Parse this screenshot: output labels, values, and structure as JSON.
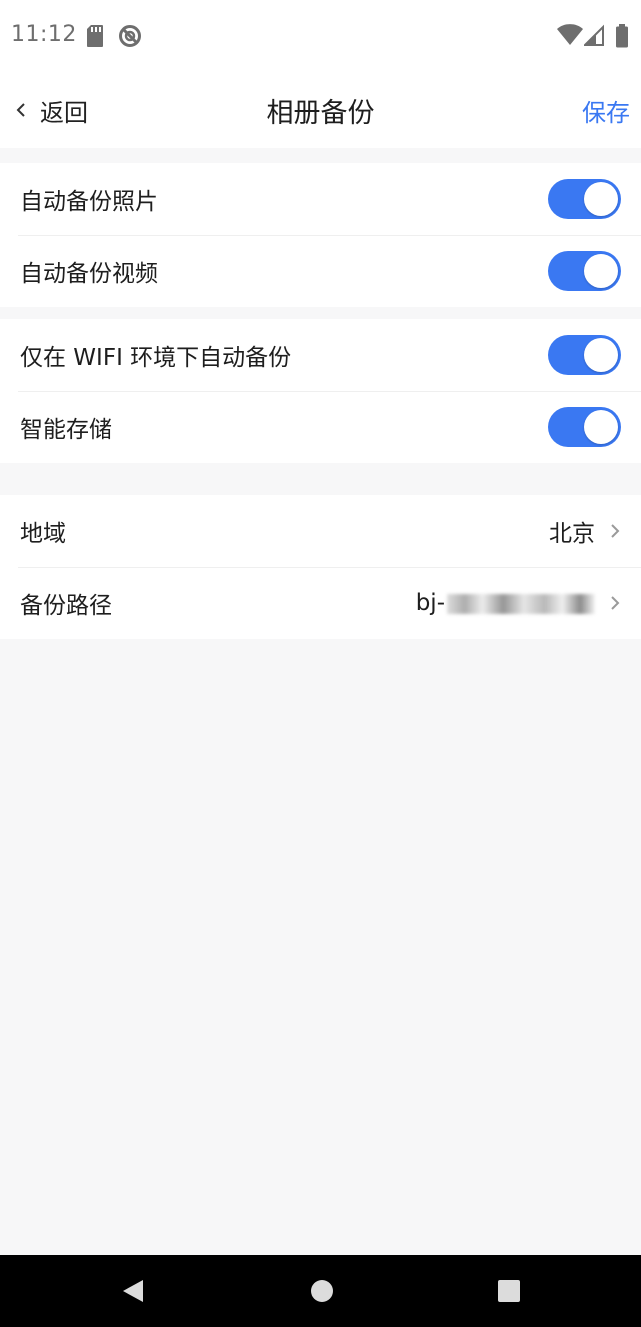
{
  "status_bar": {
    "time": "11:12",
    "left_icons": [
      "sd-card-icon",
      "no-disturb-icon"
    ],
    "right_icons": [
      "wifi-icon",
      "cell-signal-icon",
      "battery-icon"
    ]
  },
  "nav": {
    "back_label": "返回",
    "title": "相册备份",
    "save_label": "保存"
  },
  "groups": [
    {
      "rows": [
        {
          "label": "自动备份照片",
          "toggle_on": true
        },
        {
          "label": "自动备份视频",
          "toggle_on": true
        }
      ]
    },
    {
      "rows": [
        {
          "label": "仅在 WIFI 环境下自动备份",
          "toggle_on": true
        },
        {
          "label": "智能存储",
          "toggle_on": true
        }
      ]
    },
    {
      "rows": [
        {
          "label": "地域",
          "value": "北京"
        },
        {
          "label": "备份路径",
          "value": "bj-"
        }
      ]
    }
  ],
  "colors": {
    "accent": "#3a78f2",
    "page_background": "#f7f7f8",
    "card_background": "#ffffff"
  },
  "android_nav": [
    "back-triangle-icon",
    "home-circle-icon",
    "recents-square-icon"
  ]
}
